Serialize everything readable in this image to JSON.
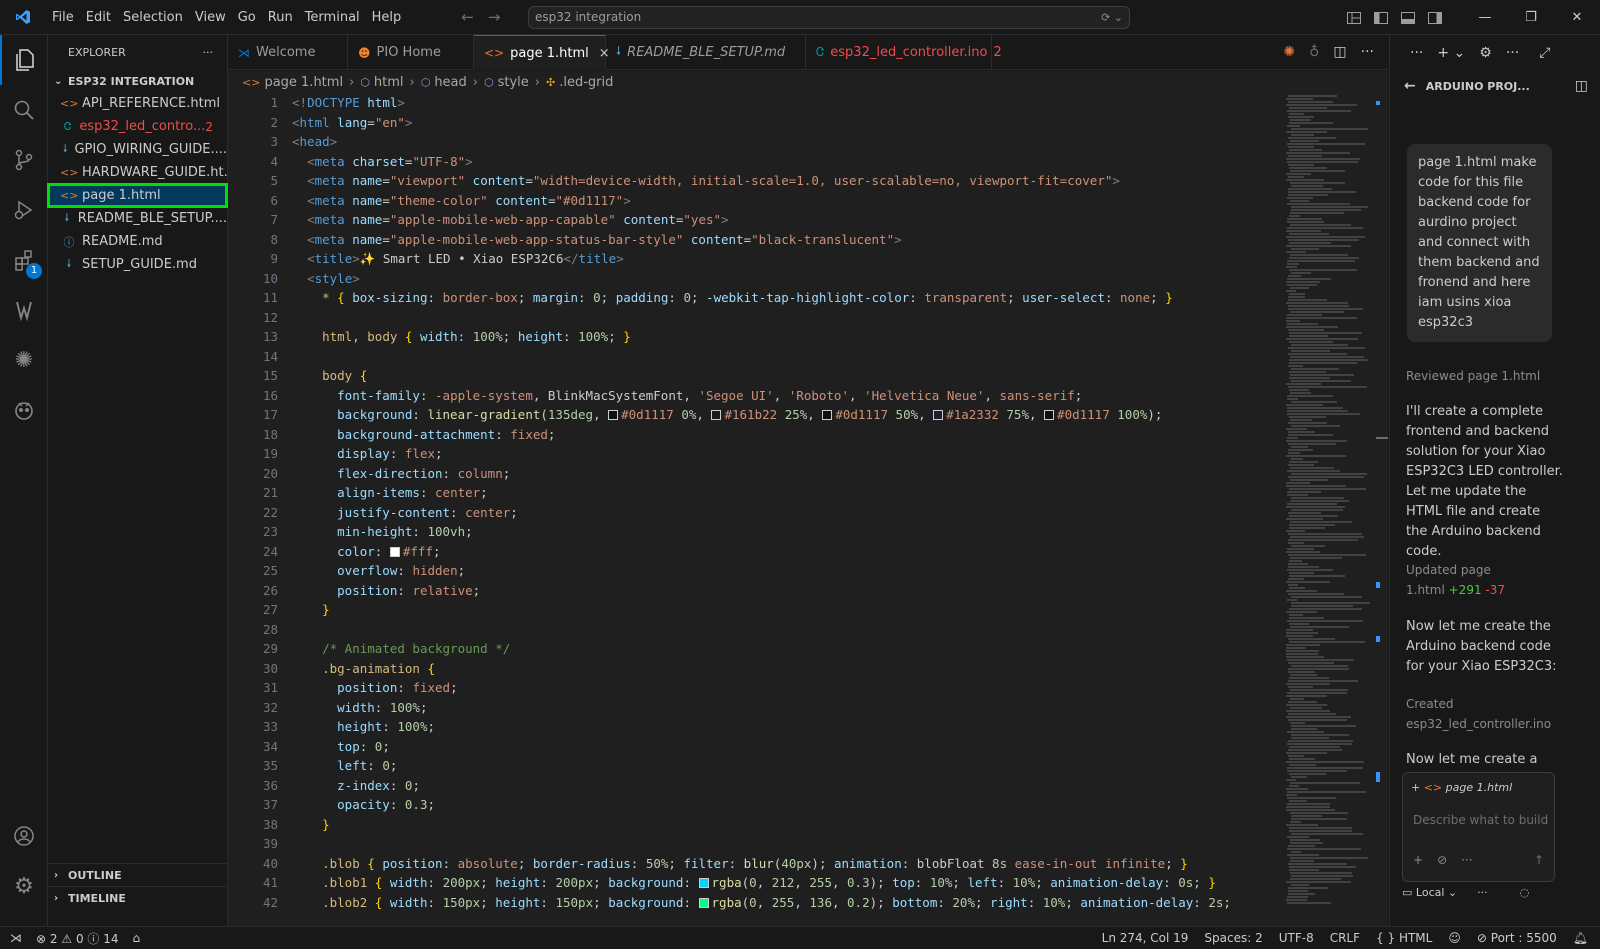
{
  "titlebar": {
    "menu": [
      "File",
      "Edit",
      "Selection",
      "View",
      "Go",
      "Run",
      "Terminal",
      "Help"
    ],
    "search": "esp32 integration"
  },
  "activity": {
    "extensions_badge": "1"
  },
  "explorer": {
    "title": "EXPLORER",
    "more": "···",
    "folder": "ESP32 INTEGRATION",
    "files": [
      {
        "name": "API_REFERENCE.html",
        "icon": "<>",
        "color": "#e37933"
      },
      {
        "name": "esp32_led_contro...",
        "icon": "Ꮳ",
        "color": "#00979d",
        "count": "2"
      },
      {
        "name": "GPIO_WIRING_GUIDE....",
        "icon": "🠗",
        "color": "#519aba"
      },
      {
        "name": "HARDWARE_GUIDE.ht...",
        "icon": "<>",
        "color": "#e37933"
      },
      {
        "name": "page 1.html",
        "icon": "<>",
        "color": "#e37933"
      },
      {
        "name": "README_BLE_SETUP....",
        "icon": "🠗",
        "color": "#519aba"
      },
      {
        "name": "README.md",
        "icon": "ⓘ",
        "color": "#519aba"
      },
      {
        "name": "SETUP_GUIDE.md",
        "icon": "🠗",
        "color": "#519aba"
      }
    ],
    "outline": "OUTLINE",
    "timeline": "TIMELINE"
  },
  "tabs": [
    {
      "label": "Welcome",
      "icon": "⋊",
      "icon_color": "#0078d4"
    },
    {
      "label": "PIO Home",
      "icon": "☻",
      "icon_color": "#f5822a"
    },
    {
      "label": "page 1.html",
      "icon": "<>",
      "icon_color": "#e37933",
      "close": "×"
    },
    {
      "label": "README_BLE_SETUP.md",
      "icon": "🠗",
      "icon_color": "#519aba"
    },
    {
      "label": "esp32_led_controller.ino",
      "icon": "Ꮳ",
      "icon_color": "#00979d",
      "count": "2"
    }
  ],
  "breadcrumb": [
    "page 1.html",
    "html",
    "head",
    "style",
    ".led-grid"
  ],
  "editor": {
    "lines": [
      "<span class=\"t\">&lt;!</span><span class=\"tg\">DOCTYPE</span> <span class=\"at\">html</span><span class=\"t\">&gt;</span>",
      "<span class=\"t\">&lt;</span><span class=\"tg\">html</span> <span class=\"at\">lang</span>=<span class=\"st\">\"en\"</span><span class=\"t\">&gt;</span>",
      "<span class=\"t\">&lt;</span><span class=\"tg\">head</span><span class=\"t\">&gt;</span>",
      "  <span class=\"t\">&lt;</span><span class=\"tg\">meta</span> <span class=\"at\">charset</span>=<span class=\"st\">\"UTF-8\"</span><span class=\"t\">&gt;</span>",
      "  <span class=\"t\">&lt;</span><span class=\"tg\">meta</span> <span class=\"at\">name</span>=<span class=\"st\">\"viewport\"</span> <span class=\"at\">content</span>=<span class=\"st\">\"width=device-width, initial-scale=1.0, user-scalable=no, viewport-fit=cover\"</span><span class=\"t\">&gt;</span>",
      "  <span class=\"t\">&lt;</span><span class=\"tg\">meta</span> <span class=\"at\">name</span>=<span class=\"st\">\"theme-color\"</span> <span class=\"at\">content</span>=<span class=\"st\">\"#0d1117\"</span><span class=\"t\">&gt;</span>",
      "  <span class=\"t\">&lt;</span><span class=\"tg\">meta</span> <span class=\"at\">name</span>=<span class=\"st\">\"apple-mobile-web-app-capable\"</span> <span class=\"at\">content</span>=<span class=\"st\">\"yes\"</span><span class=\"t\">&gt;</span>",
      "  <span class=\"t\">&lt;</span><span class=\"tg\">meta</span> <span class=\"at\">name</span>=<span class=\"st\">\"apple-mobile-web-app-status-bar-style\"</span> <span class=\"at\">content</span>=<span class=\"st\">\"black-translucent\"</span><span class=\"t\">&gt;</span>",
      "  <span class=\"t\">&lt;</span><span class=\"tg\">title</span><span class=\"t\">&gt;</span>✨ Smart LED • Xiao ESP32C6<span class=\"t\">&lt;/</span><span class=\"tg\">title</span><span class=\"t\">&gt;</span>",
      "  <span class=\"t\">&lt;</span><span class=\"tg\">style</span><span class=\"t\">&gt;</span>",
      "    <span class=\"sel\">*</span> <span class=\"br\">{</span> <span class=\"pr\">box-sizing</span>: <span class=\"vl\">border-box</span>; <span class=\"pr\">margin</span>: <span class=\"nm\">0</span>; <span class=\"pr\">padding</span>: <span class=\"nm\">0</span>; <span class=\"pr\">-webkit-tap-highlight-color</span>: <span class=\"vl\">transparent</span>; <span class=\"pr\">user-select</span>: <span class=\"vl\">none</span>; <span class=\"br\">}</span>",
      "",
      "    <span class=\"sel\">html</span>, <span class=\"sel\">body</span> <span class=\"br\">{</span> <span class=\"pr\">width</span>: <span class=\"nm\">100%</span>; <span class=\"pr\">height</span>: <span class=\"nm\">100%</span>; <span class=\"br\">}</span>",
      "",
      "    <span class=\"sel\">body</span> <span class=\"br\">{</span>",
      "      <span class=\"pr\">font-family</span>: <span class=\"vl\">-apple-system</span>, BlinkMacSystemFont, <span class=\"st\">'Segoe UI'</span>, <span class=\"st\">'Roboto'</span>, <span class=\"st\">'Helvetica Neue'</span>, <span class=\"vl\">sans-serif</span>;",
      "      <span class=\"pr\">background</span>: <span class=\"fn\">linear-gradient</span>(<span class=\"nm\">135deg</span>, <span class=\"sw\" style=\"background:#0d1117\"></span><span class=\"vl\">#0d1117</span> <span class=\"nm\">0%</span>, <span class=\"sw\" style=\"background:#161b22\"></span><span class=\"vl\">#161b22</span> <span class=\"nm\">25%</span>, <span class=\"sw\" style=\"background:#0d1117\"></span><span class=\"vl\">#0d1117</span> <span class=\"nm\">50%</span>, <span class=\"sw\" style=\"background:#1a2332\"></span><span class=\"vl\">#1a2332</span> <span class=\"nm\">75%</span>, <span class=\"sw\" style=\"background:#0d1117\"></span><span class=\"vl\">#0d1117</span> <span class=\"nm\">100%</span>);",
      "      <span class=\"pr\">background-attachment</span>: <span class=\"vl\">fixed</span>;",
      "      <span class=\"pr\">display</span>: <span class=\"vl\">flex</span>;",
      "      <span class=\"pr\">flex-direction</span>: <span class=\"vl\">column</span>;",
      "      <span class=\"pr\">align-items</span>: <span class=\"vl\">center</span>;",
      "      <span class=\"pr\">justify-content</span>: <span class=\"vl\">center</span>;",
      "      <span class=\"pr\">min-height</span>: <span class=\"nm\">100vh</span>;",
      "      <span class=\"pr\">color</span>: <span class=\"sw\" style=\"background:#ffffff\"></span><span class=\"vl\">#fff</span>;",
      "      <span class=\"pr\">overflow</span>: <span class=\"vl\">hidden</span>;",
      "      <span class=\"pr\">position</span>: <span class=\"vl\">relative</span>;",
      "    <span class=\"br\">}</span>",
      "",
      "    <span class=\"cm\">/* Animated background */</span>",
      "    <span class=\"sel\">.bg-animation</span> <span class=\"br\">{</span>",
      "      <span class=\"pr\">position</span>: <span class=\"vl\">fixed</span>;",
      "      <span class=\"pr\">width</span>: <span class=\"nm\">100%</span>;",
      "      <span class=\"pr\">height</span>: <span class=\"nm\">100%</span>;",
      "      <span class=\"pr\">top</span>: <span class=\"nm\">0</span>;",
      "      <span class=\"pr\">left</span>: <span class=\"nm\">0</span>;",
      "      <span class=\"pr\">z-index</span>: <span class=\"nm\">0</span>;",
      "      <span class=\"pr\">opacity</span>: <span class=\"nm\">0.3</span>;",
      "    <span class=\"br\">}</span>",
      "",
      "    <span class=\"sel\">.blob</span> <span class=\"br\">{</span> <span class=\"pr\">position</span>: <span class=\"vl\">absolute</span>; <span class=\"pr\">border-radius</span>: <span class=\"nm\">50%</span>; <span class=\"pr\">filter</span>: <span class=\"fn\">blur</span>(<span class=\"nm\">40px</span>); <span class=\"pr\">animation</span>: blobFloat <span class=\"nm\">8s</span> <span class=\"vl\">ease-in-out</span> <span class=\"vl\">infinite</span>; <span class=\"br\">}</span>",
      "    <span class=\"sel\">.blob1</span> <span class=\"br\">{</span> <span class=\"pr\">width</span>: <span class=\"nm\">200px</span>; <span class=\"pr\">height</span>: <span class=\"nm\">200px</span>; <span class=\"pr\">background</span>: <span class=\"sw\" style=\"background:#00d4ff\"></span><span class=\"fn\">rgba</span>(<span class=\"nm\">0</span>, <span class=\"nm\">212</span>, <span class=\"nm\">255</span>, <span class=\"nm\">0.3</span>); <span class=\"pr\">top</span>: <span class=\"nm\">10%</span>; <span class=\"pr\">left</span>: <span class=\"nm\">10%</span>; <span class=\"pr\">animation-delay</span>: <span class=\"nm\">0s</span>; <span class=\"br\">}</span>",
      "    <span class=\"sel\">.blob2</span> <span class=\"br\">{</span> <span class=\"pr\">width</span>: <span class=\"nm\">150px</span>; <span class=\"pr\">height</span>: <span class=\"nm\">150px</span>; <span class=\"pr\">background</span>: <span class=\"sw\" style=\"background:#00ff88\"></span><span class=\"fn\">rgba</span>(<span class=\"nm\">0</span>, <span class=\"nm\">255</span>, <span class=\"nm\">136</span>, <span class=\"nm\">0.2</span>); <span class=\"pr\">bottom</span>: <span class=\"nm\">20%</span>; <span class=\"pr\">right</span>: <span class=\"nm\">10%</span>; <span class=\"pr\">animation-delay</span>: <span class=\"nm\">2s</span>;"
    ]
  },
  "chat": {
    "title": "ARDUINO PROJ...",
    "user_message": "page 1.html make code for this file backend code for aurdino project and connect with them backend and fronend and here iam usins xioa esp32c3",
    "reviewed": "Reviewed page 1.html",
    "reply1": "I'll create a complete frontend and backend solution for your Xiao ESP32C3 LED controller. Let me update the HTML file and create the Arduino backend code.",
    "updated_label": "Updated page",
    "updated_file": "1.html",
    "added": "+291",
    "removed": "-37",
    "reply2": "Now let me create the Arduino backend code for your Xiao ESP32C3:",
    "created_label": "Created",
    "created_file": "esp32_led_controller.ino",
    "reply3": "Now let me create a",
    "chip": "page 1.html",
    "placeholder": "Describe what to build",
    "mode": "Local"
  },
  "status": {
    "errors": "2",
    "warnings": "0",
    "info": "14",
    "position": "Ln 274, Col 19",
    "spaces": "Spaces: 2",
    "encoding": "UTF-8",
    "eol": "CRLF",
    "language": "HTML",
    "port": "Port : 5500"
  },
  "colors": {
    "accent": "#0078d4",
    "highlight": "#00e000",
    "error": "#f14c4c",
    "added": "#4ec940",
    "removed": "#f14c4c"
  }
}
